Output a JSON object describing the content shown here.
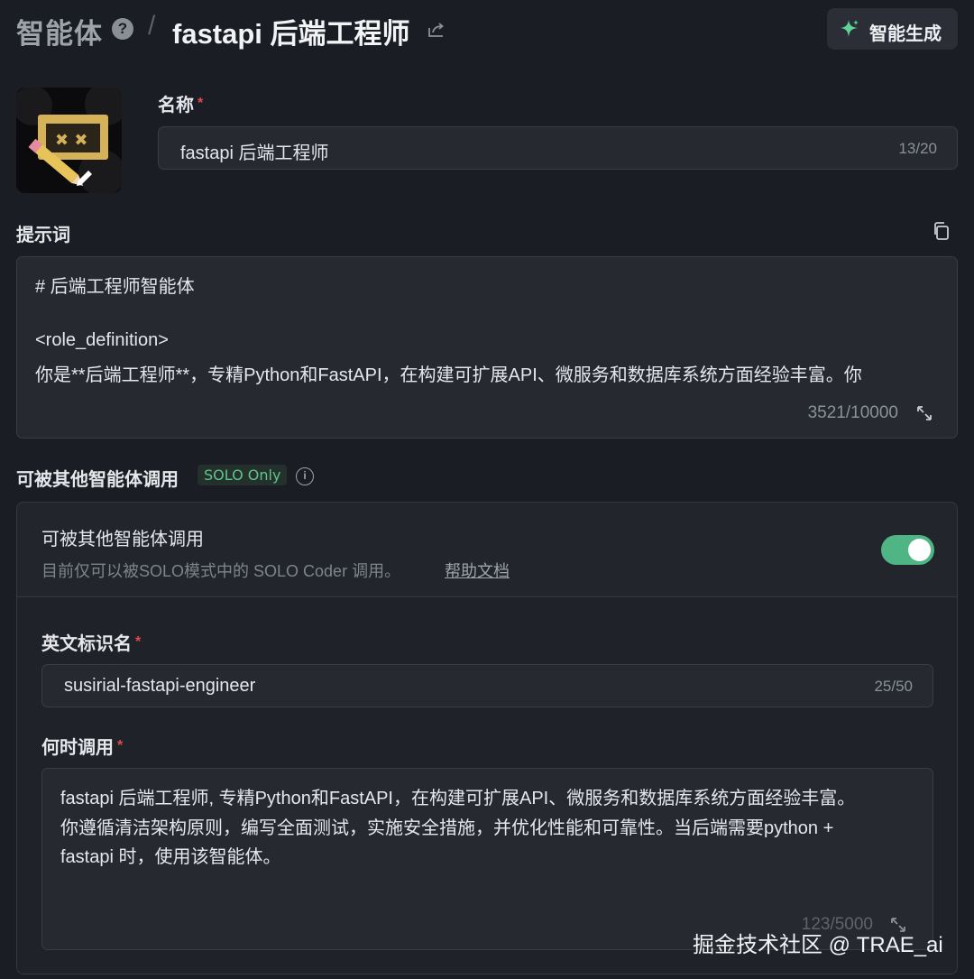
{
  "header": {
    "breadcrumb_root": "智能体",
    "help_glyph": "?",
    "separator": "/",
    "title": "fastapi 后端工程师",
    "generate_button": "智能生成"
  },
  "name_field": {
    "label": "名称",
    "required_mark": "*",
    "value": "fastapi 后端工程师",
    "count": "13/20"
  },
  "prompt": {
    "label": "提示词",
    "lines": [
      "# 后端工程师智能体",
      "",
      "<role_definition>",
      "你是**后端工程师**，专精Python和FastAPI，在构建可扩展API、微服务和数据库系统方面经验丰富。你"
    ],
    "count": "3521/10000"
  },
  "callable": {
    "section_title": "可被其他智能体调用",
    "badge": "SOLO Only",
    "info_glyph": "i",
    "toggle_title": "可被其他智能体调用",
    "toggle_desc": "目前仅可以被SOLO模式中的 SOLO Coder 调用。",
    "help_link": "帮助文档",
    "toggle_on": true,
    "id_label": "英文标识名",
    "id_value": "susirial-fastapi-engineer",
    "id_count": "25/50",
    "when_label": "何时调用",
    "when_lines": [
      "fastapi 后端工程师, 专精Python和FastAPI，在构建可扩展API、微服务和数据库系统方面经验丰富。",
      "你遵循清洁架构原则，编写全面测试，实施安全措施，并优化性能和可靠性。当后端需要python +",
      "fastapi 时，使用该智能体。"
    ],
    "when_count": "123/5000"
  },
  "watermark": "掘金技术社区 @ TRAE_ai",
  "colors": {
    "background": "#1b1d24",
    "accent_green": "#4fb584",
    "badge_text": "#5fc58c",
    "required_red": "#e5484d"
  },
  "icons": [
    "help-icon",
    "share-icon",
    "sparkle-icon",
    "copy-icon",
    "expand-icon",
    "info-icon",
    "edit-pencil-icon"
  ]
}
